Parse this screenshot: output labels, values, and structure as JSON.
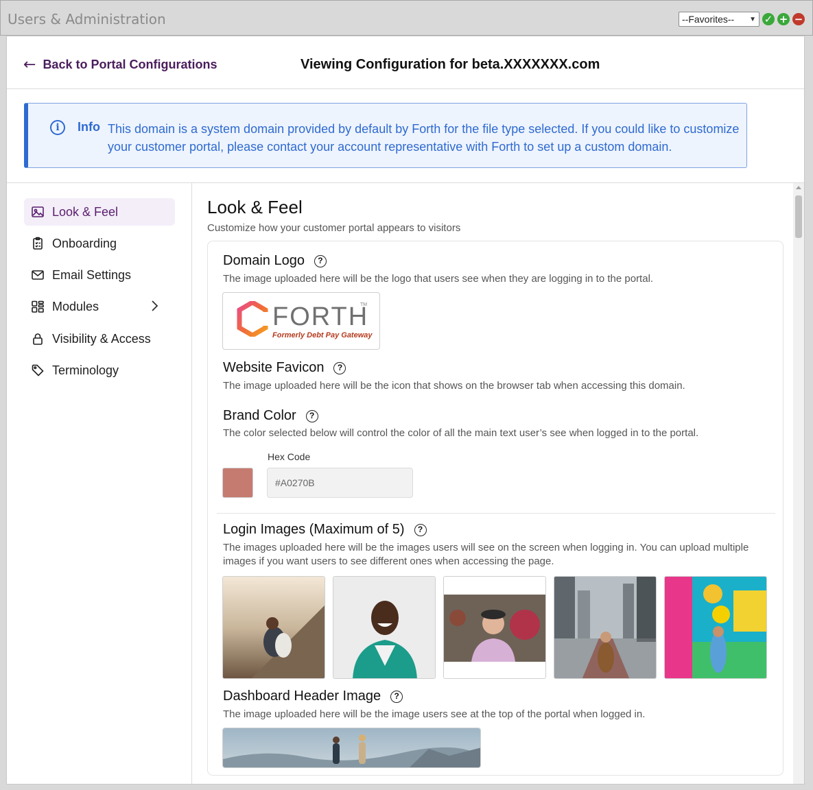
{
  "app": {
    "title": "Users & Administration",
    "favorites": "--Favorites--"
  },
  "header": {
    "back_label": "Back to Portal Configurations",
    "view_title": "Viewing Configuration for beta.XXXXXXX.com"
  },
  "info": {
    "label": "Info",
    "text": "This domain is a system domain provided by default by Forth for the file type selected. If you could like to customize your customer portal, please contact your account representative with Forth to set up a custom domain."
  },
  "sidebar": {
    "items": [
      {
        "label": "Look & Feel",
        "icon": "image-icon",
        "active": true
      },
      {
        "label": "Onboarding",
        "icon": "clipboard-icon"
      },
      {
        "label": "Email Settings",
        "icon": "envelope-icon"
      },
      {
        "label": "Modules",
        "icon": "grid-icon",
        "has_submenu": true
      },
      {
        "label": "Visibility & Access",
        "icon": "lock-icon"
      },
      {
        "label": "Terminology",
        "icon": "tag-icon"
      }
    ]
  },
  "content": {
    "title": "Look & Feel",
    "subtitle": "Customize how your customer portal appears to visitors",
    "domain_logo": {
      "title": "Domain Logo",
      "desc": "The image uploaded here will be the logo that users see when they are logging in to the portal.",
      "logo_word": "FORTH",
      "logo_tm": "TM",
      "logo_tag": "Formerly Debt Pay Gateway"
    },
    "favicon": {
      "title": "Website Favicon",
      "desc": "The image uploaded here will be the icon that shows on the browser tab when accessing this domain."
    },
    "brand_color": {
      "title": "Brand Color",
      "desc": "The color selected below will control the color of all the main text user’s see when logged in to the portal.",
      "hex_label": "Hex Code",
      "hex_placeholder": "#A0270B",
      "swatch_color": "#c57b70"
    },
    "login_images": {
      "title": "Login Images (Maximum of 5)",
      "desc": "The images uploaded here will be the images users will see on the screen when logging in. You can upload multiple images if you want users to see different ones when accessing the page."
    },
    "dashboard_header": {
      "title": "Dashboard Header Image",
      "desc": "The image uploaded here will be the image users see at the top of the portal when logged in."
    }
  },
  "help_glyph": "?",
  "info_glyph": "i"
}
